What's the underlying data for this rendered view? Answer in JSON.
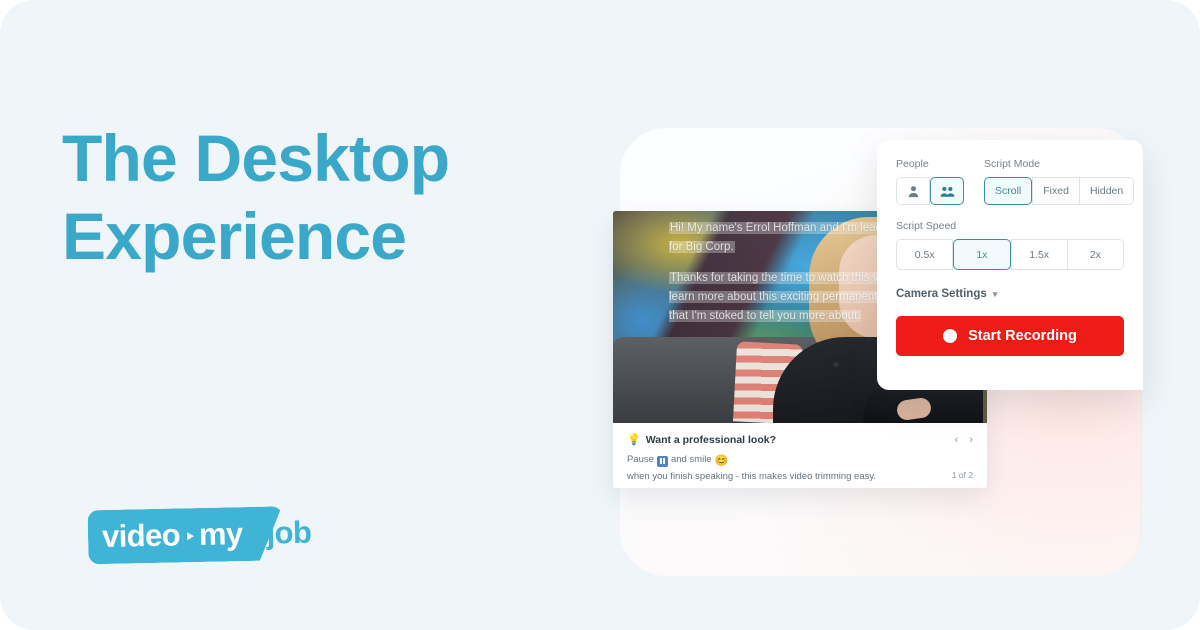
{
  "hero": {
    "headline_line1": "The Desktop",
    "headline_line2": "Experience",
    "headline_color": "#3aa8c9"
  },
  "logo": {
    "word_video": "video",
    "word_my": "my",
    "word_job": "job",
    "badge_color": "#3fb4d6",
    "play_icon": "play-icon"
  },
  "video_card": {
    "prompter": {
      "paragraph_1": "Hi! My name's Errol Hoffman and I'm lead recruiter for Big Corp.",
      "paragraph_2": "Thanks for taking the time to watch this video to learn more about this exciting permanent position that I'm stoked to tell you more about."
    },
    "tip": {
      "bulb_icon": "lightbulb-icon",
      "title": "Want a professional look?",
      "body_before": "Pause",
      "pause_icon": "pause-icon",
      "body_middle": "and smile",
      "smile_icon": "smiling-face-icon",
      "body_after": "when you finish speaking - this makes video trimming easy.",
      "prev_icon": "chevron-left-icon",
      "next_icon": "chevron-right-icon",
      "counter": "1 of 2"
    }
  },
  "panel": {
    "people": {
      "label": "People",
      "options": [
        {
          "icon": "single-person-icon",
          "selected": false
        },
        {
          "icon": "two-people-icon",
          "selected": true
        }
      ]
    },
    "script_mode": {
      "label": "Script Mode",
      "options": [
        {
          "label": "Scroll",
          "selected": true
        },
        {
          "label": "Fixed",
          "selected": false
        },
        {
          "label": "Hidden",
          "selected": false
        }
      ]
    },
    "script_speed": {
      "label": "Script Speed",
      "options": [
        {
          "label": "0.5x",
          "selected": false
        },
        {
          "label": "1x",
          "selected": true
        },
        {
          "label": "1.5x",
          "selected": false
        },
        {
          "label": "2x",
          "selected": false
        }
      ]
    },
    "camera_settings": {
      "label": "Camera Settings",
      "chevron_icon": "chevron-down-icon"
    },
    "record": {
      "label": "Start Recording",
      "dot_icon": "record-dot-icon",
      "color": "#ed1c16"
    },
    "accent_color": "#3e8ca3"
  }
}
